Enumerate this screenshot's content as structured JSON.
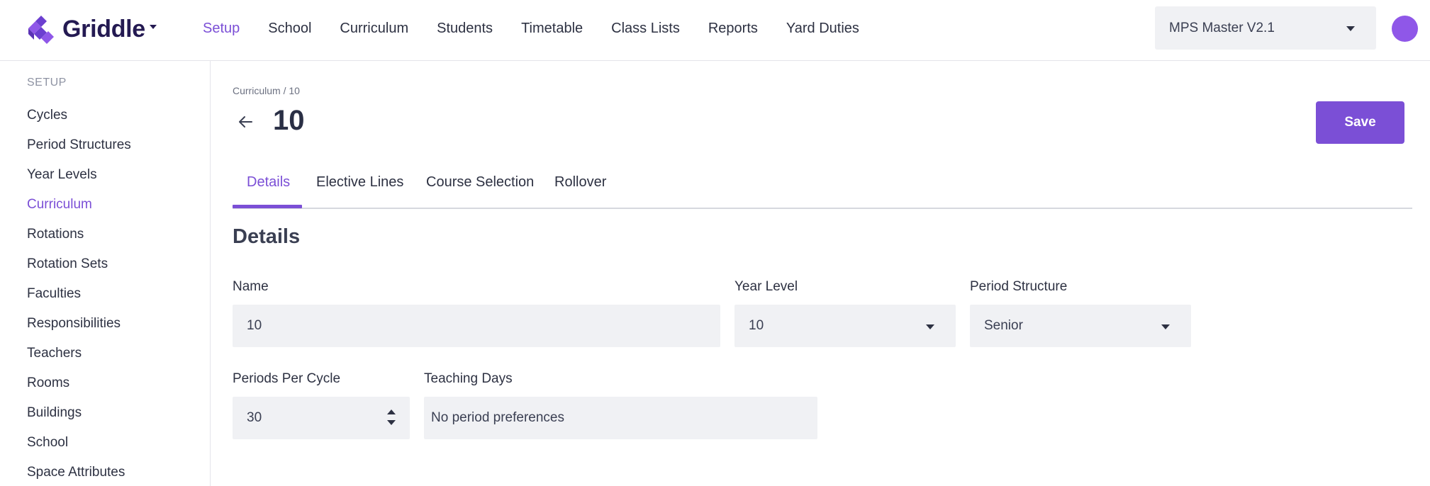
{
  "brand": {
    "name": "Griddle",
    "accent": "#7b4fd6"
  },
  "nav": {
    "items": [
      {
        "label": "Setup",
        "active": true
      },
      {
        "label": "School"
      },
      {
        "label": "Curriculum"
      },
      {
        "label": "Students"
      },
      {
        "label": "Timetable"
      },
      {
        "label": "Class Lists"
      },
      {
        "label": "Reports"
      },
      {
        "label": "Yard Duties"
      }
    ],
    "school_select": {
      "value": "MPS Master V2.1"
    }
  },
  "sidebar": {
    "heading": "SETUP",
    "items": [
      {
        "label": "Cycles"
      },
      {
        "label": "Period Structures"
      },
      {
        "label": "Year Levels"
      },
      {
        "label": "Curriculum",
        "active": true
      },
      {
        "label": "Rotations"
      },
      {
        "label": "Rotation Sets"
      },
      {
        "label": "Faculties"
      },
      {
        "label": "Responsibilities"
      },
      {
        "label": "Teachers"
      },
      {
        "label": "Rooms"
      },
      {
        "label": "Buildings"
      },
      {
        "label": "School"
      },
      {
        "label": "Space Attributes"
      }
    ]
  },
  "page": {
    "breadcrumb": "Curriculum / 10",
    "title": "10",
    "save_label": "Save"
  },
  "tabs": [
    {
      "label": "Details",
      "active": true
    },
    {
      "label": "Elective Lines"
    },
    {
      "label": "Course Selection"
    },
    {
      "label": "Rollover"
    }
  ],
  "details": {
    "section_title": "Details",
    "name": {
      "label": "Name",
      "value": "10"
    },
    "year_level": {
      "label": "Year Level",
      "value": "10"
    },
    "period_structure": {
      "label": "Period Structure",
      "value": "Senior"
    },
    "periods_per_cycle": {
      "label": "Periods Per Cycle",
      "value": "30"
    },
    "teaching_days": {
      "label": "Teaching Days",
      "value": "No period preferences"
    }
  }
}
